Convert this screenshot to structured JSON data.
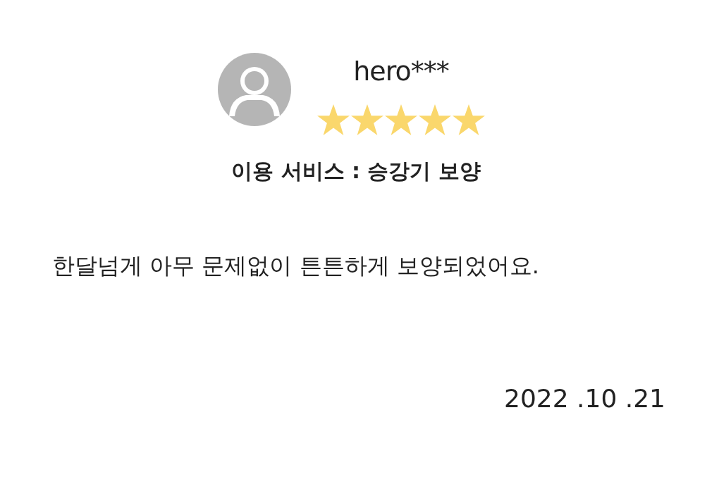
{
  "review": {
    "author": "hero***",
    "stars": 5,
    "service": "이용 서비스 : 승강기 보양",
    "text": "한달넘게 아무 문제없이 튼튼하게 보양되었어요.",
    "date": "2022 .10 .21"
  }
}
